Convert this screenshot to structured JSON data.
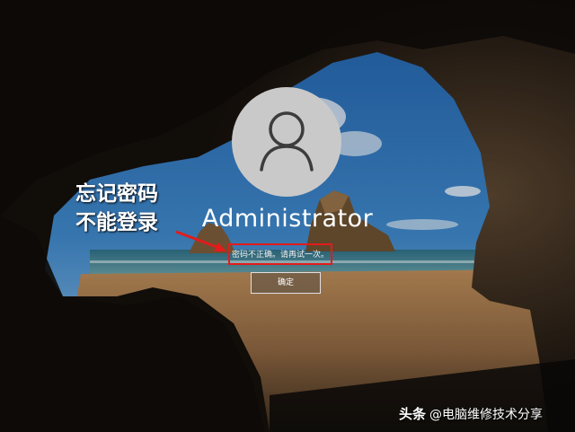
{
  "login": {
    "avatar_icon": "user-icon",
    "username": "Administrator",
    "error_message": "密码不正确。请再试一次。",
    "ok_button_label": "确定"
  },
  "annotation": {
    "line1": "忘记密码",
    "line2": "不能登录",
    "highlight_color": "#e21b1b"
  },
  "watermark": {
    "brand": "头条",
    "handle": "@电脑维修技术分享"
  }
}
